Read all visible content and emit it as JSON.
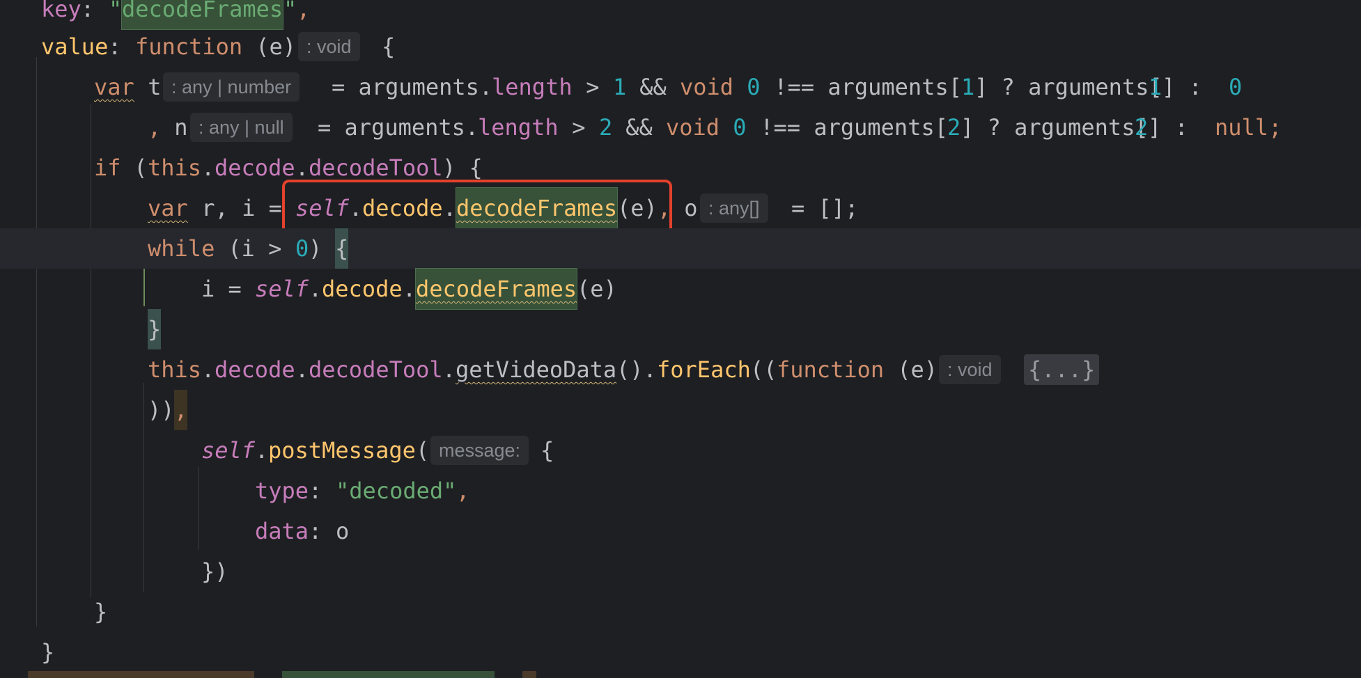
{
  "editor": {
    "lines": [
      {
        "key_label": "key",
        "colon": ": ",
        "q1": "\"",
        "key_value": "decodeFrames",
        "q2": "\"",
        "comma": ","
      },
      {
        "value_label": "value",
        "colon": ": ",
        "function_kw": "function",
        "params": " (e)",
        "hint": ": void",
        "brace": "{"
      },
      {
        "var_kw": "var",
        "t_name": " t",
        "hint": ": any | number",
        "rest_a": "= arguments.",
        "length": "length",
        "rest_b": " > ",
        "num1": "1",
        "rest_c": " && ",
        "void_kw": "void",
        "num0": " 0",
        "rest_d": " !== arguments[",
        "num1b": "1",
        "rest_e": "] ? arguments[",
        "num1c": "1",
        "rest_f": "] : ",
        "num0b": "0"
      },
      {
        "comma": ",",
        "n_name": " n",
        "hint": ": any | null",
        "rest_a": "= arguments.",
        "length": "length",
        "rest_b": " > ",
        "num2": "2",
        "rest_c": " && ",
        "void_kw": "void",
        "num0": " 0",
        "rest_d": " !== arguments[",
        "num2b": "2",
        "rest_e": "] ? arguments[",
        "num2c": "2",
        "rest_f": "] : ",
        "null_kw": "null;"
      },
      {
        "if_kw": "if",
        "paren": " (",
        "this_kw": "this",
        "dot1": ".",
        "decode": "decode",
        "dot2": ".",
        "decodeTool": "decodeTool",
        "close": ") {"
      },
      {
        "var_kw": "var",
        "names": " r, i = ",
        "self_kw": "self",
        "dot1": ".",
        "decode": "decode",
        "dot2": ".",
        "decodeFrames": "decodeFrames",
        "args": "(e)",
        "comma": ",",
        "o_name": " o",
        "hint": ": any[]",
        "rest": "= [];"
      },
      {
        "while_kw": "while",
        "cond_a": " (i > ",
        "num0": "0",
        "cond_b": ") ",
        "brace": "{"
      },
      {
        "assign": "i = ",
        "self_kw": "self",
        "dot1": ".",
        "decode": "decode",
        "dot2": ".",
        "decodeFrames": "decodeFrames",
        "args": "(e)"
      },
      {
        "brace": "}"
      },
      {
        "this_kw": "this",
        "dot1": ".",
        "decode": "decode",
        "dot2": ".",
        "decodeTool": "decodeTool",
        "dot3": ".",
        "getVideoData": "getVideoData",
        "call": "().",
        "forEach": "forEach",
        "open": "((",
        "function_kw": "function",
        "params": " (e)",
        "hint": ": void",
        "fold": "{...}"
      },
      {
        "close": "))",
        "comma": ","
      },
      {
        "self_kw": "self",
        "dot": ".",
        "postMessage": "postMessage",
        "open": "(",
        "hint": "message:",
        "brace": "{"
      },
      {
        "type_key": "type",
        "colon": ": ",
        "type_value": "\"decoded\"",
        "comma": ","
      },
      {
        "data_key": "data",
        "colon": ": ",
        "data_value": "o"
      },
      {
        "close": "})"
      },
      {
        "brace": "}"
      },
      {
        "brace": "}"
      }
    ]
  }
}
